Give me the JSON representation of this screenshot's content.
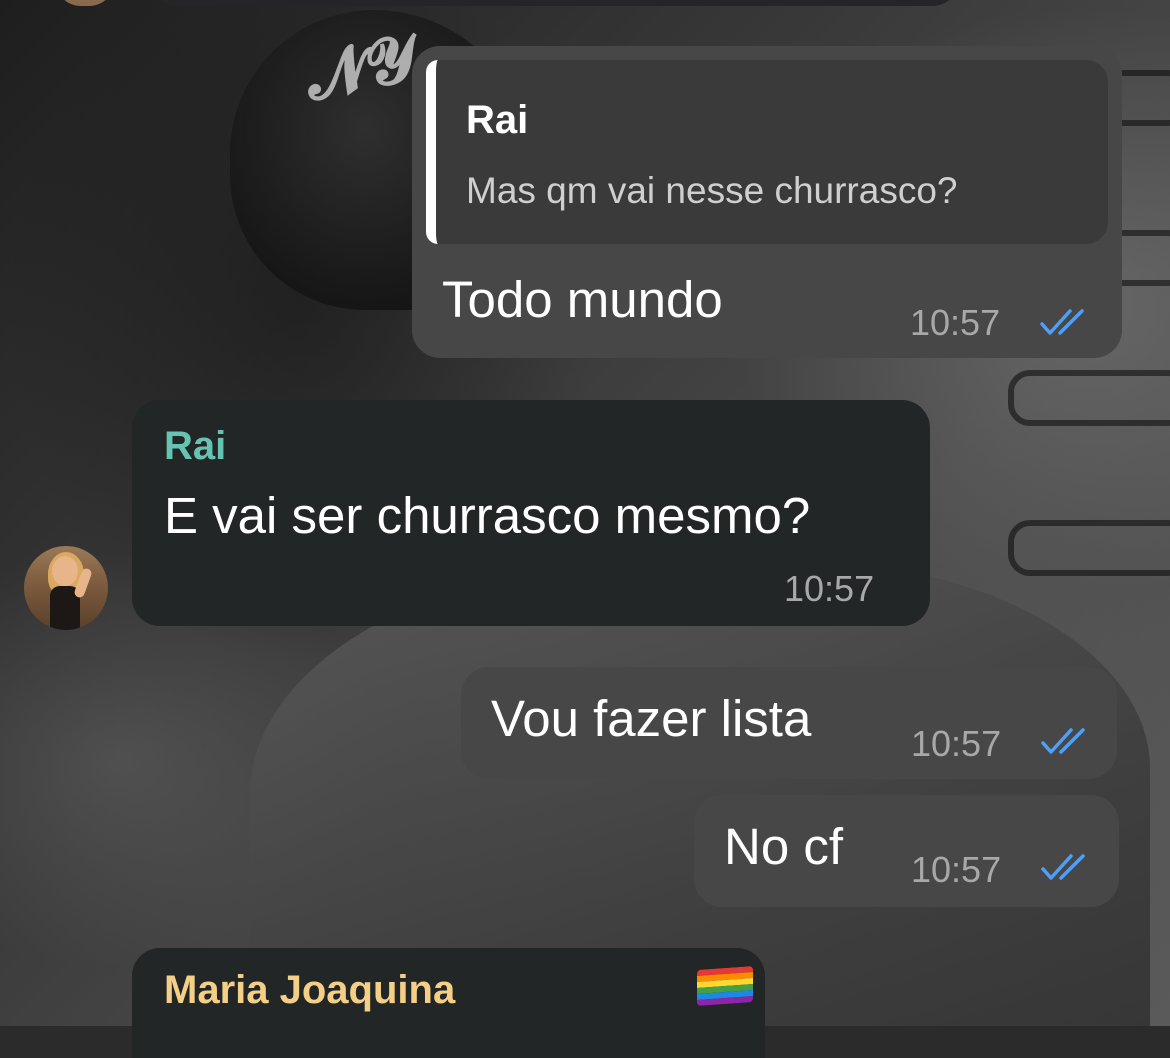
{
  "chat": {
    "messages": [
      {
        "id": "m1",
        "direction": "outgoing",
        "reply_to": {
          "sender": "Rai",
          "text": "Mas qm vai nesse churrasco?"
        },
        "text": "Todo mundo",
        "time": "10:57",
        "status": "read"
      },
      {
        "id": "m2",
        "direction": "incoming",
        "sender": "Rai",
        "text": "E vai ser churrasco mesmo?",
        "time": "10:57"
      },
      {
        "id": "m3",
        "direction": "outgoing",
        "text": "Vou fazer lista",
        "time": "10:57",
        "status": "read"
      },
      {
        "id": "m4",
        "direction": "outgoing",
        "text": "No cf",
        "time": "10:57",
        "status": "read"
      },
      {
        "id": "m5",
        "direction": "incoming",
        "sender": "Maria Joaquina",
        "sender_emoji": "rainbow-flag"
      }
    ]
  },
  "colors": {
    "outgoing_bubble": "#474747",
    "incoming_bubble": "#232626",
    "sender_rai": "#67c3b1",
    "sender_maria": "#f5cf86",
    "read_ticks": "#4f9ff7",
    "timestamp": "#a8a8a8"
  }
}
